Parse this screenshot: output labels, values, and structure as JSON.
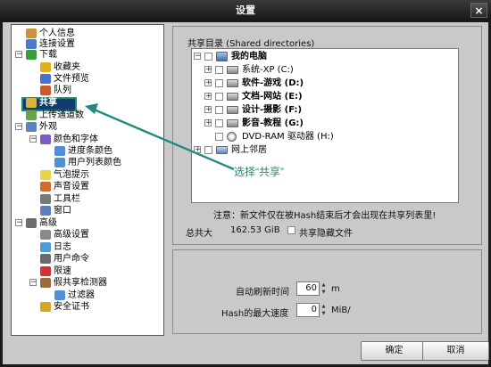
{
  "window": {
    "title": "设置",
    "close_glyph": "×"
  },
  "nav": {
    "items": [
      {
        "label": "个人信息",
        "icon": "person-icon"
      },
      {
        "label": "连接设置",
        "icon": "connection-icon"
      },
      {
        "label": "下载",
        "icon": "download-icon",
        "expanded": true
      },
      {
        "label": "收藏夹",
        "icon": "favorites-icon"
      },
      {
        "label": "文件预览",
        "icon": "preview-icon"
      },
      {
        "label": "队列",
        "icon": "queue-icon"
      },
      {
        "label": "共享",
        "icon": "share-icon",
        "selected": true
      },
      {
        "label": "上传通道数",
        "icon": "upload-slots-icon"
      },
      {
        "label": "外观",
        "icon": "appearance-icon",
        "expanded": true
      },
      {
        "label": "颜色和字体",
        "icon": "colors-fonts-icon",
        "expanded": true
      },
      {
        "label": "进度条颜色",
        "icon": "progress-colors-icon"
      },
      {
        "label": "用户列表颜色",
        "icon": "userlist-colors-icon"
      },
      {
        "label": "气泡提示",
        "icon": "balloon-icon"
      },
      {
        "label": "声音设置",
        "icon": "sound-icon"
      },
      {
        "label": "工具栏",
        "icon": "toolbar-icon"
      },
      {
        "label": "窗口",
        "icon": "window-icon"
      },
      {
        "label": "高级",
        "icon": "advanced-icon",
        "expanded": true
      },
      {
        "label": "高级设置",
        "icon": "advanced-settings-icon"
      },
      {
        "label": "日志",
        "icon": "log-icon"
      },
      {
        "label": "用户命令",
        "icon": "user-commands-icon"
      },
      {
        "label": "限速",
        "icon": "limit-icon"
      },
      {
        "label": "假共享检测器",
        "icon": "fake-share-detector-icon",
        "expanded": true
      },
      {
        "label": "过滤器",
        "icon": "filter-icon"
      },
      {
        "label": "安全证书",
        "icon": "certificate-icon"
      }
    ]
  },
  "annotation": {
    "text": "选择“共享”",
    "color": "#1f8a7e"
  },
  "shared": {
    "group_title": "共享目录 (Shared directories)",
    "tree": [
      {
        "label": "我的电脑",
        "bold": true,
        "icon": "computer-icon"
      },
      {
        "label": "系统-XP (C:)",
        "bold": false,
        "icon": "drive-icon"
      },
      {
        "label": "软件-游戏 (D:)",
        "bold": true,
        "icon": "drive-icon"
      },
      {
        "label": "文档-网站 (E:)",
        "bold": true,
        "icon": "drive-icon"
      },
      {
        "label": "设计-摄影 (F:)",
        "bold": true,
        "icon": "drive-icon"
      },
      {
        "label": "影音-教程 (G:)",
        "bold": true,
        "icon": "drive-icon"
      },
      {
        "label": "DVD-RAM 驱动器 (H:)",
        "bold": false,
        "icon": "dvd-icon"
      },
      {
        "label": "网上邻居",
        "bold": false,
        "icon": "network-icon"
      }
    ],
    "note": "注意：新文件仅在被Hash结束后才会出现在共享列表里!",
    "total_label": "总共大",
    "total_value": "162.53 GiB",
    "hidden_label": "共享隐藏文件"
  },
  "refresh": {
    "auto_label": "自动刷新时间",
    "auto_value": "60",
    "auto_unit": "m",
    "hash_label": "Hash的最大速度",
    "hash_value": "0",
    "hash_unit": "MiB/"
  },
  "buttons": {
    "ok": "确定",
    "cancel": "取消"
  }
}
